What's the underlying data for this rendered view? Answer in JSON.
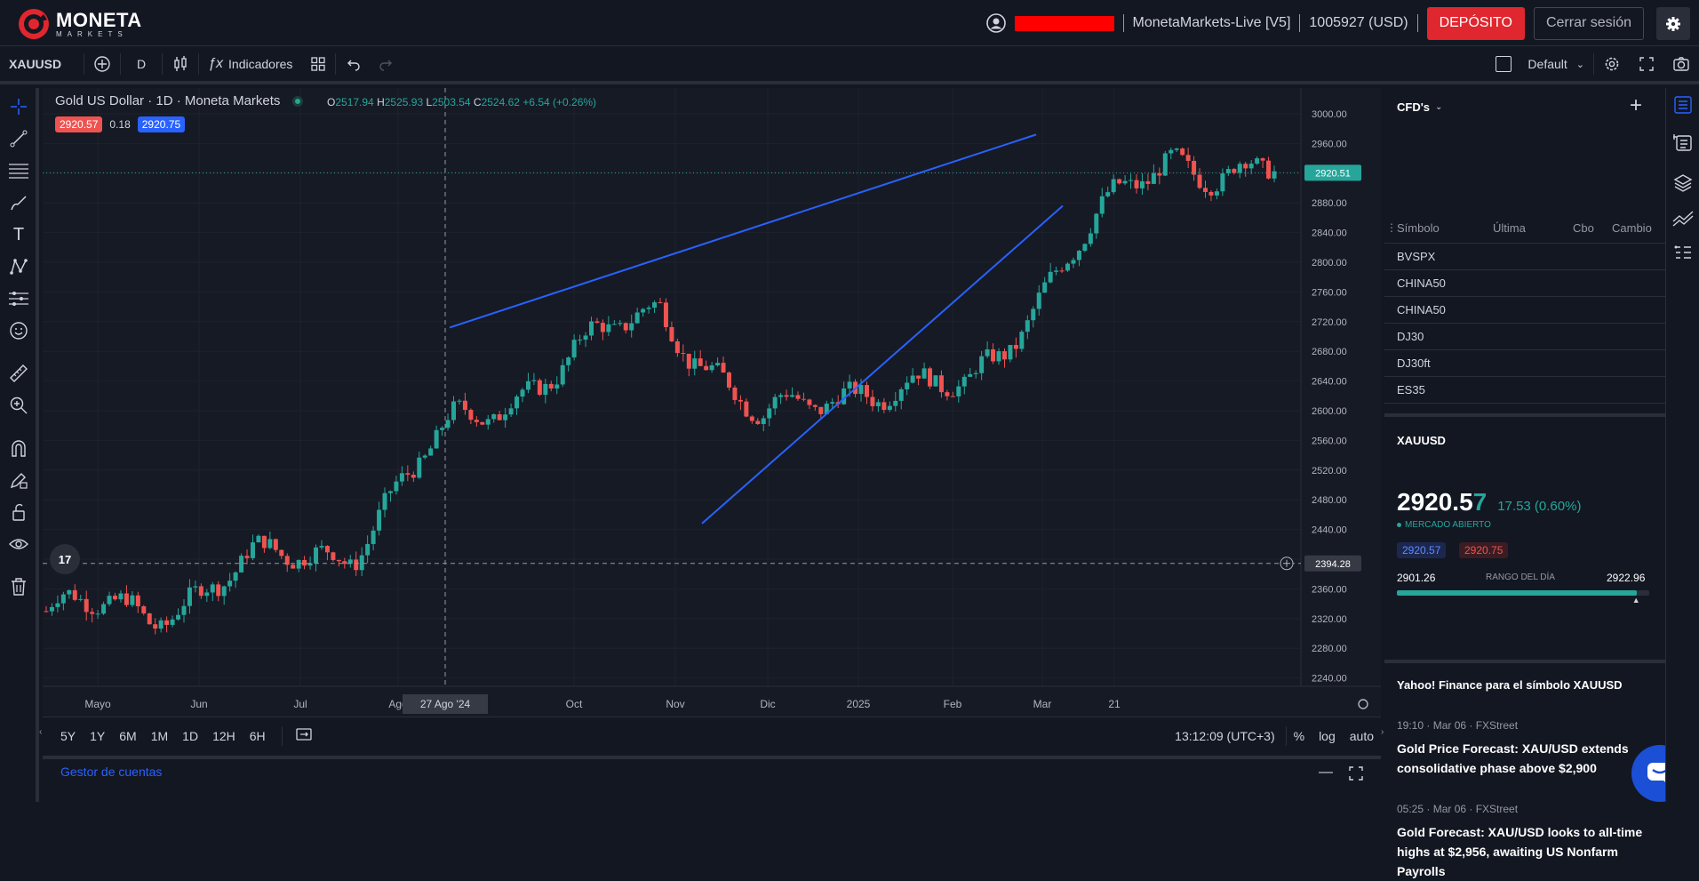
{
  "header": {
    "brand_name": "MONETA",
    "brand_sub": "MARKETS",
    "account_server": "MonetaMarkets-Live [V5]",
    "account_id": "1005927 (USD)",
    "deposit_label": "DEPÓSITO",
    "logout_label": "Cerrar sesión"
  },
  "toolbar": {
    "symbol": "XAUUSD",
    "interval": "D",
    "indicators_label": "Indicadores",
    "layout_name": "Default"
  },
  "legend": {
    "title": "Gold US Dollar · 1D · Moneta Markets",
    "o_label": "O",
    "o": "2517.94",
    "h_label": "H",
    "h": "2525.93",
    "l_label": "L",
    "l": "2503.54",
    "c_label": "C",
    "c": "2524.62",
    "change": "+6.54 (+0.26%)",
    "bid": "2920.57",
    "spread": "0.18",
    "ask": "2920.75"
  },
  "chart_data": {
    "type": "candlestick",
    "symbol": "XAUUSD",
    "title": "Gold US Dollar · 1D · Moneta Markets",
    "y_ticks": [
      "3000.00",
      "2960.00",
      "2920.00",
      "2880.00",
      "2840.00",
      "2800.00",
      "2760.00",
      "2720.00",
      "2680.00",
      "2640.00",
      "2600.00",
      "2560.00",
      "2520.00",
      "2480.00",
      "2440.00",
      "2400.00",
      "2360.00",
      "2320.00",
      "2280.00",
      "2240.00"
    ],
    "ylim": [
      2220,
      3020
    ],
    "x_ticks": [
      "Mayo",
      "Jun",
      "Jul",
      "Ago",
      "27 Ago '24",
      "Oct",
      "Nov",
      "Dic",
      "2025",
      "Feb",
      "Mar",
      "21"
    ],
    "last_price_label": "2920.51",
    "crosshair_price_label": "2394.28",
    "crosshair_date_label": "27 Ago '24",
    "monthly_path": [
      {
        "month": "Mayo",
        "value": 2330
      },
      {
        "month": "Jun",
        "value": 2330
      },
      {
        "month": "Jul",
        "value": 2390
      },
      {
        "month": "Ago",
        "value": 2420
      },
      {
        "month": "Sep",
        "value": 2580
      },
      {
        "month": "Oct",
        "value": 2660
      },
      {
        "month": "Nov",
        "value": 2740
      },
      {
        "month": "Nov2",
        "value": 2580
      },
      {
        "month": "Dic",
        "value": 2640
      },
      {
        "month": "2025",
        "value": 2620
      },
      {
        "month": "Feb",
        "value": 2820
      },
      {
        "month": "Feb2",
        "value": 2940
      },
      {
        "month": "Mar",
        "value": 2920
      }
    ],
    "trendlines": [
      {
        "name": "upper",
        "from": {
          "date": "Sep",
          "value": 2712
        },
        "to": {
          "date": "Mar+",
          "value": 2972
        }
      },
      {
        "name": "lower",
        "from": {
          "date": "Nov",
          "value": 2448
        },
        "to": {
          "date": "Mar+",
          "value": 2876
        }
      }
    ]
  },
  "bottom": {
    "timeframes": [
      "5Y",
      "1Y",
      "6M",
      "1M",
      "1D",
      "12H",
      "6H"
    ],
    "clock": "13:12:09 (UTC+3)",
    "pct": "%",
    "log": "log",
    "auto": "auto",
    "account_manager": "Gestor de cuentas"
  },
  "watchlist": {
    "title": "CFD's",
    "col_symbol": "Símbolo",
    "col_last": "Última",
    "col_change": "Cbo",
    "col_change_pct": "Cambio",
    "rows": [
      "BVSPX",
      "CHINA50",
      "CHINA50",
      "DJ30",
      "DJ30ft",
      "ES35"
    ]
  },
  "details": {
    "symbol": "XAUUSD",
    "price_main": "2920.5",
    "price_last": "7",
    "change": "17.53 (0.60%)",
    "status": "MERCADO ABIERTO",
    "bid": "2920.57",
    "ask": "2920.75",
    "range_low": "2901.26",
    "range_label": "RANGO DEL DÍA",
    "range_high": "2922.96",
    "range_fill": 0.95
  },
  "news": {
    "header": "Yahoo! Finance para el símbolo XAUUSD",
    "items": [
      {
        "meta": "19:10 · Mar 06 · FXStreet",
        "title": "Gold Price Forecast: XAU/USD extends consolidative phase above $2,900"
      },
      {
        "meta": "05:25 · Mar 06 · FXStreet",
        "title": "Gold Forecast: XAU/USD looks to all-time highs at $2,956, awaiting US Nonfarm Payrolls"
      }
    ]
  },
  "colors": {
    "up": "#26a69a",
    "down": "#ef5350",
    "accent_red": "#e0262e",
    "trendline": "#2962ff",
    "bid_badge": "#ef5350",
    "ask_badge": "#2962ff"
  }
}
